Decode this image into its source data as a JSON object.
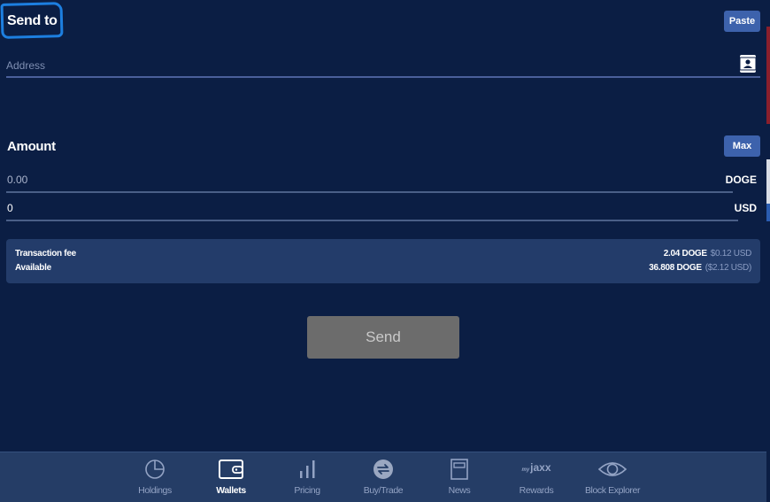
{
  "send_to": {
    "title": "Send to",
    "paste_label": "Paste",
    "address_placeholder": "Address",
    "address_value": "",
    "contacts_icon": "address-book-icon"
  },
  "amount": {
    "title": "Amount",
    "max_label": "Max",
    "crypto_value": "0.00",
    "crypto_unit": "DOGE",
    "fiat_value": "0",
    "fiat_unit": "USD"
  },
  "fee_box": {
    "fee_label": "Transaction fee",
    "fee_crypto": "2.04 DOGE",
    "fee_fiat": "$0.12 USD",
    "available_label": "Available",
    "available_crypto": "36.808 DOGE",
    "available_fiat": "($2.12 USD)"
  },
  "send_button": {
    "label": "Send",
    "enabled": false
  },
  "bottom_nav": {
    "active": "Wallets",
    "items": [
      {
        "label": "Holdings",
        "icon": "pie-chart-icon"
      },
      {
        "label": "Wallets",
        "icon": "wallet-icon"
      },
      {
        "label": "Pricing",
        "icon": "bar-chart-icon"
      },
      {
        "label": "Buy/Trade",
        "icon": "exchange-icon"
      },
      {
        "label": "News",
        "icon": "newspaper-icon"
      },
      {
        "label": "Rewards",
        "icon": "jaxx-logo-icon",
        "logo_text": "jaxx",
        "logo_prefix": "my"
      },
      {
        "label": "Block Explorer",
        "icon": "eye-icon"
      }
    ]
  },
  "colors": {
    "background": "#0b1e44",
    "panel": "#233c6a",
    "nav": "#253d66",
    "accent_button": "#3d62ac",
    "disabled_button": "#6c6c6c",
    "annotation": "#1d7fe0"
  }
}
